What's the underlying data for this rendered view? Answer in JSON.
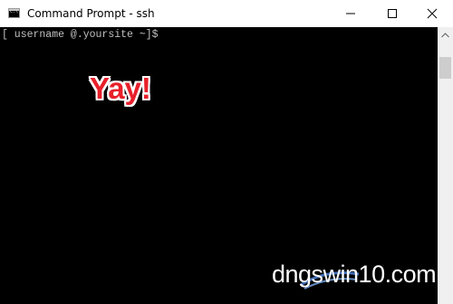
{
  "window": {
    "title": "Command Prompt - ssh",
    "app_icon": "console-icon",
    "controls": {
      "minimize_icon": "minimize-icon",
      "maximize_icon": "maximize-icon",
      "close_icon": "close-icon"
    }
  },
  "console": {
    "prompt": "[ username @.yoursite ~]$",
    "overlay_text": "Yay!",
    "background": "#000000",
    "text_color": "#c0c0c0"
  },
  "scrollbar": {
    "up_icon": "scroll-up-arrow-icon"
  },
  "watermark": {
    "text": "dngswin10.com",
    "logo": "watermark-logo"
  },
  "colors": {
    "overlay_red": "#e8202a",
    "watermark_blue": "#4a7ed0"
  }
}
